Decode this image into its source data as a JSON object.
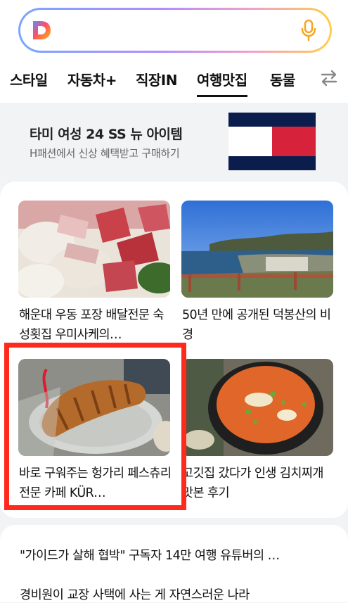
{
  "search": {
    "placeholder": ""
  },
  "tabs": [
    {
      "label": "스타일"
    },
    {
      "label": "자동차+"
    },
    {
      "label": "직장IN"
    },
    {
      "label": "여행맛집",
      "active": true
    },
    {
      "label": "동물"
    }
  ],
  "ad": {
    "title": "타미 여성 24 SS 뉴 아이템",
    "subtitle": "H패션에서 신상 혜택받고 구매하기"
  },
  "grid": [
    {
      "caption": "해운대 우동 포장 배달전문 숙성횟집 우미사케의…",
      "image": "sashimi-photo"
    },
    {
      "caption": "50년 만에 공개된 덕봉산의 비경",
      "image": "coastline-photo"
    },
    {
      "caption": "바로 구워주는 헝가리 페스츄리 전문 카페 KÜR…",
      "image": "pastry-photo"
    },
    {
      "caption": "고깃집 갔다가 인생 김치찌개 맛본 후기",
      "image": "kimchi-stew-photo"
    }
  ],
  "list": [
    {
      "text": "\"가이드가 살해 협박\" 구독자 14만 여행 유튜버의 …"
    },
    {
      "text": "경비원이 교장 사택에 사는 게 자연스러운 나라"
    }
  ],
  "colors": {
    "highlight": "#ff2a1c",
    "flag_navy": "#0b1d4d",
    "flag_red": "#d6233b"
  }
}
